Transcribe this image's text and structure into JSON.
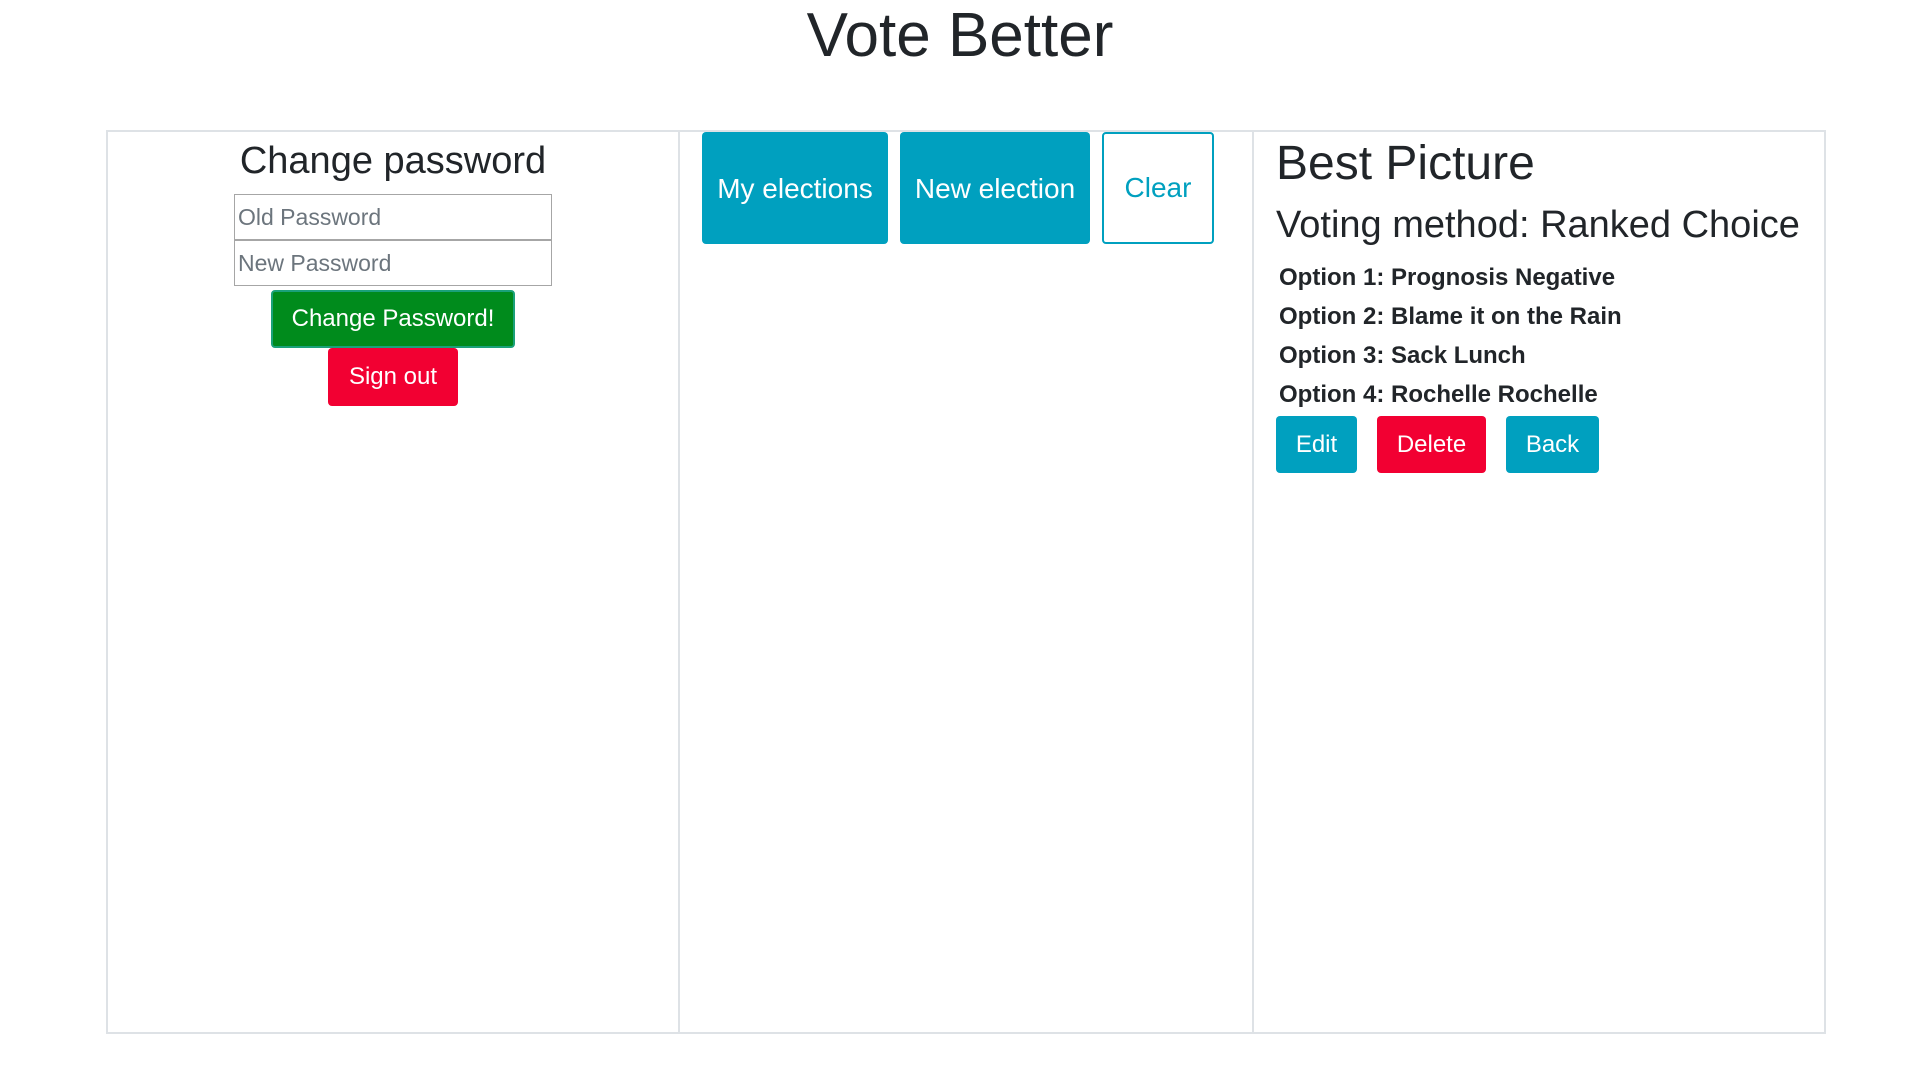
{
  "app": {
    "title": "Vote Better"
  },
  "account": {
    "heading": "Change password",
    "old_password_placeholder": "Old Password",
    "new_password_placeholder": "New Password",
    "change_password_label": "Change Password!",
    "sign_out_label": "Sign out"
  },
  "elections_nav": {
    "my_elections_label": "My elections",
    "new_election_label": "New election",
    "clear_label": "Clear"
  },
  "election": {
    "title": "Best Picture",
    "voting_method": "Voting method: Ranked Choice",
    "options": [
      "Option 1: Prognosis Negative",
      "Option 2: Blame it on the Rain",
      "Option 3: Sack Lunch",
      "Option 4: Rochelle Rochelle"
    ],
    "edit_label": "Edit",
    "delete_label": "Delete",
    "back_label": "Back"
  },
  "colors": {
    "primary": "#00a0bf",
    "success": "#008b1c",
    "danger": "#f20032",
    "border": "#dee2e6"
  }
}
